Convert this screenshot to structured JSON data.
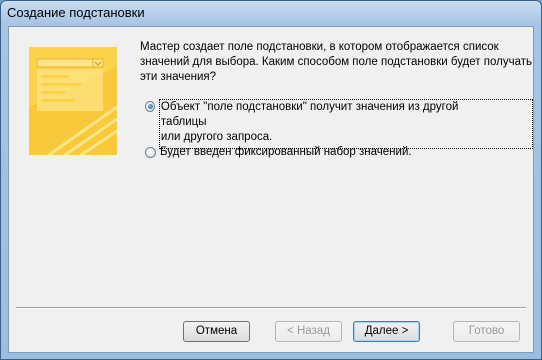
{
  "window": {
    "title": "Создание подстановки"
  },
  "description": {
    "lines": [
      "Мастер создает поле подстановки, в котором отображается список",
      "значений для выбора.  Каким способом поле подстановки будет получать",
      " эти значения?"
    ]
  },
  "options": [
    {
      "lines": [
        "Объект \"поле подстановки\" получит значения из другой таблицы",
        "или другого запроса."
      ],
      "checked": true
    },
    {
      "lines": [
        "Будет введен фиксированный набор значений."
      ],
      "checked": false
    }
  ],
  "buttons": {
    "cancel": "Отмена",
    "back": "< Назад",
    "next": "Далее >",
    "finish": "Готово"
  },
  "colors": {
    "illustration_base": "#fbd34a",
    "illustration_light": "#fde58a"
  }
}
